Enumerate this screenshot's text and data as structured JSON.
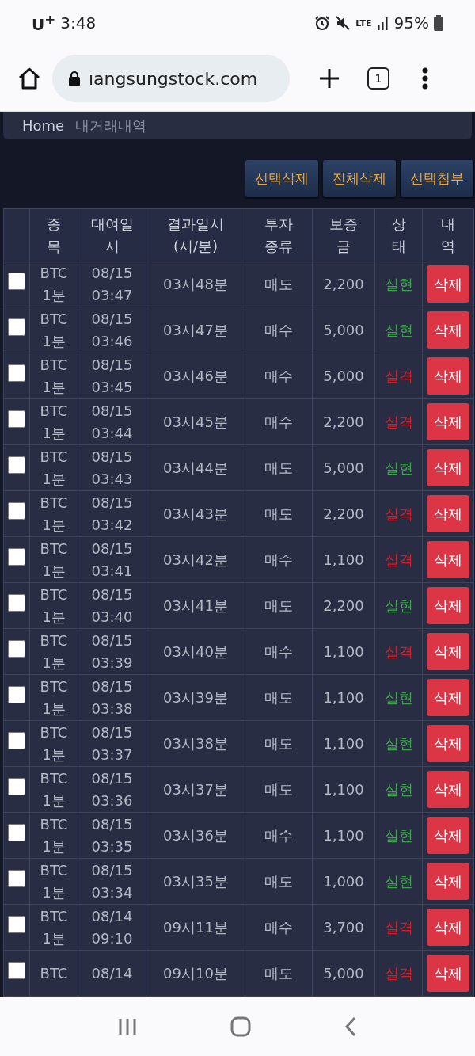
{
  "status_bar": {
    "carrier": "U$^{+}$",
    "time": "3:48",
    "network": "LTE",
    "battery": "95%"
  },
  "browser": {
    "url": "ıangsungstock.com",
    "tab_count": "1"
  },
  "breadcrumb": {
    "home": "Home",
    "current": "내거래내역"
  },
  "actions": [
    "선택삭제",
    "전체삭제",
    "선택첨부"
  ],
  "table": {
    "columns": [
      {},
      {
        "lines": [
          "종",
          "목"
        ]
      },
      {
        "lines": [
          "대여일",
          "시"
        ]
      },
      {
        "lines": [
          "결과일시",
          "(시/분)"
        ]
      },
      {
        "lines": [
          "투자",
          "종류"
        ]
      },
      {
        "lines": [
          "보증",
          "금"
        ]
      },
      {
        "lines": [
          "상",
          "태"
        ]
      },
      {
        "lines": [
          "내",
          "역"
        ]
      }
    ],
    "rows": [
      {
        "checked": false,
        "symbol": [
          "BTC",
          "1분"
        ],
        "date": [
          "08/15",
          "03:47"
        ],
        "result_time": "03시48분",
        "type": "매도",
        "deposit": "2,200",
        "status": "실현",
        "kind": "win",
        "action": "삭제"
      },
      {
        "checked": false,
        "symbol": [
          "BTC",
          "1분"
        ],
        "date": [
          "08/15",
          "03:46"
        ],
        "result_time": "03시47분",
        "type": "매수",
        "deposit": "5,000",
        "status": "실현",
        "kind": "win",
        "action": "삭제"
      },
      {
        "checked": false,
        "symbol": [
          "BTC",
          "1분"
        ],
        "date": [
          "08/15",
          "03:45"
        ],
        "result_time": "03시46분",
        "type": "매수",
        "deposit": "5,000",
        "status": "실격",
        "kind": "lose",
        "action": "삭제"
      },
      {
        "checked": false,
        "symbol": [
          "BTC",
          "1분"
        ],
        "date": [
          "08/15",
          "03:44"
        ],
        "result_time": "03시45분",
        "type": "매수",
        "deposit": "2,200",
        "status": "실격",
        "kind": "lose",
        "action": "삭제"
      },
      {
        "checked": false,
        "symbol": [
          "BTC",
          "1분"
        ],
        "date": [
          "08/15",
          "03:43"
        ],
        "result_time": "03시44분",
        "type": "매도",
        "deposit": "5,000",
        "status": "실현",
        "kind": "win",
        "action": "삭제"
      },
      {
        "checked": false,
        "symbol": [
          "BTC",
          "1분"
        ],
        "date": [
          "08/15",
          "03:42"
        ],
        "result_time": "03시43분",
        "type": "매도",
        "deposit": "2,200",
        "status": "실격",
        "kind": "lose",
        "action": "삭제"
      },
      {
        "checked": false,
        "symbol": [
          "BTC",
          "1분"
        ],
        "date": [
          "08/15",
          "03:41"
        ],
        "result_time": "03시42분",
        "type": "매수",
        "deposit": "1,100",
        "status": "실격",
        "kind": "lose",
        "action": "삭제"
      },
      {
        "checked": false,
        "symbol": [
          "BTC",
          "1분"
        ],
        "date": [
          "08/15",
          "03:40"
        ],
        "result_time": "03시41분",
        "type": "매도",
        "deposit": "2,200",
        "status": "실현",
        "kind": "win",
        "action": "삭제"
      },
      {
        "checked": false,
        "symbol": [
          "BTC",
          "1분"
        ],
        "date": [
          "08/15",
          "03:39"
        ],
        "result_time": "03시40분",
        "type": "매수",
        "deposit": "1,100",
        "status": "실격",
        "kind": "lose",
        "action": "삭제"
      },
      {
        "checked": false,
        "symbol": [
          "BTC",
          "1분"
        ],
        "date": [
          "08/15",
          "03:38"
        ],
        "result_time": "03시39분",
        "type": "매도",
        "deposit": "1,100",
        "status": "실현",
        "kind": "win",
        "action": "삭제"
      },
      {
        "checked": false,
        "symbol": [
          "BTC",
          "1분"
        ],
        "date": [
          "08/15",
          "03:37"
        ],
        "result_time": "03시38분",
        "type": "매도",
        "deposit": "1,100",
        "status": "실현",
        "kind": "win",
        "action": "삭제"
      },
      {
        "checked": false,
        "symbol": [
          "BTC",
          "1분"
        ],
        "date": [
          "08/15",
          "03:36"
        ],
        "result_time": "03시37분",
        "type": "매도",
        "deposit": "1,100",
        "status": "실현",
        "kind": "win",
        "action": "삭제"
      },
      {
        "checked": false,
        "symbol": [
          "BTC",
          "1분"
        ],
        "date": [
          "08/15",
          "03:35"
        ],
        "result_time": "03시36분",
        "type": "매수",
        "deposit": "1,100",
        "status": "실현",
        "kind": "win",
        "action": "삭제"
      },
      {
        "checked": false,
        "symbol": [
          "BTC",
          "1분"
        ],
        "date": [
          "08/15",
          "03:34"
        ],
        "result_time": "03시35분",
        "type": "매도",
        "deposit": "1,000",
        "status": "실현",
        "kind": "win",
        "action": "삭제"
      },
      {
        "checked": false,
        "symbol": [
          "BTC",
          "1분"
        ],
        "date": [
          "08/14",
          "09:10"
        ],
        "result_time": "09시11분",
        "type": "매수",
        "deposit": "3,700",
        "status": "실격",
        "kind": "lose",
        "action": "삭제"
      },
      {
        "checked": false,
        "symbol": [
          "BTC"
        ],
        "date": [
          "08/14"
        ],
        "result_time": "09시10분",
        "type": "매도",
        "deposit": "5,000",
        "status": "실격",
        "kind": "lose",
        "action": "삭제"
      }
    ]
  }
}
